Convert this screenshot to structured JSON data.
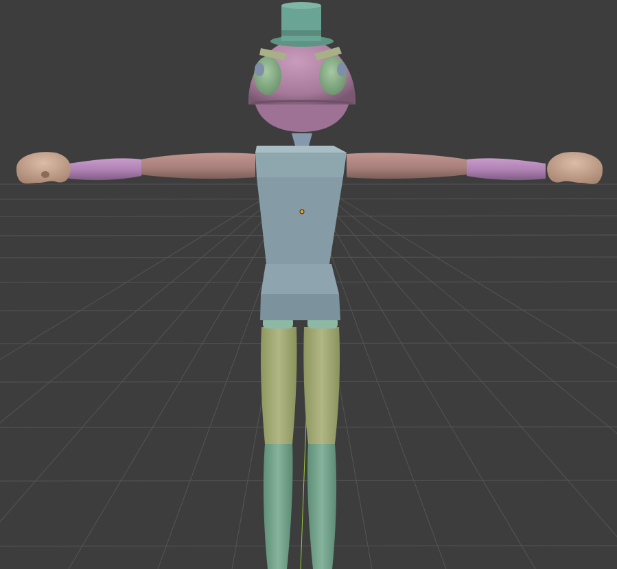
{
  "viewport": {
    "mode": "solid",
    "background_color": "#3d3d3d",
    "grid_color": "#545454",
    "y_axis_color": "#9acc3c",
    "origin_color": "#f0a030"
  },
  "character": {
    "hat_color": "#6aa494",
    "head_color": "#b582a6",
    "eye_color": "#8ab38a",
    "iris_color": "#7f8fa8",
    "brow_color": "#a8b088",
    "neck_color": "#8499ac",
    "torso_color": "#8ea6ae",
    "upper_arm_color": "#ae8782",
    "forearm_color": "#b485b8",
    "hand_color": "#c7a690",
    "thigh_color": "#a6ad7c",
    "shin_color": "#79a890"
  }
}
